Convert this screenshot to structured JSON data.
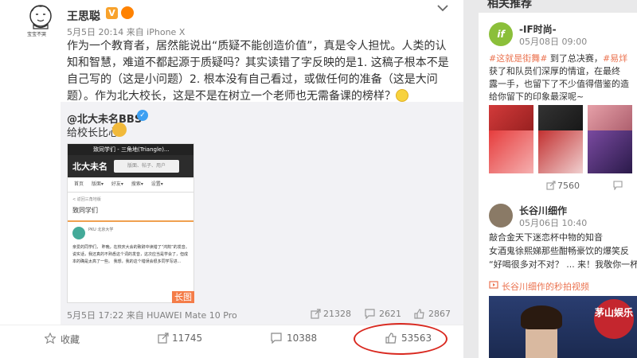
{
  "post": {
    "author": "王思聪",
    "v_badge": "V",
    "meta": "5月5日 20:14 来自 iPhone X",
    "body": "作为一个教育者，居然能说出“质疑不能创造价值”，真是令人担忧。人类的认知和智慧，难道不都起源于质疑吗？其实读错了字反映的是1. 这稿子根本不是自己写的（这是小问题）2. 根本没有自己看过，或做任何的准备（这是大问题）。作为北大校长，这是不是在树立一个老师也无需备课的榜样？",
    "avatar_label": "宝宝不哭"
  },
  "repost": {
    "author": "@北大未名BBS",
    "text": "给校长比心",
    "meta": "5月5日 17:22 来自 HUAWEI Mate 10 Pro",
    "share_count": "21328",
    "comment_count": "2621",
    "like_count": "2867",
    "long_image_tag": "长图",
    "screenshot": {
      "topbar": "致同学们 - 三角地(Triangle)...",
      "brand": "北大未名",
      "search_placeholder": "版面、帖子、用户",
      "nav": [
        "首页",
        "版面▾",
        "好友▾",
        "搜索▾",
        "设置▾"
      ],
      "back": "< 返回三角地版",
      "board_title": "致同学们",
      "poster": "PKU  北京大学",
      "post_text": "亲爱的同学们，\n  昨晚，在校庆大会的致辞中读错了“鸿鹄”的发音。说实话，我还真的不熟悉这个词的发音，这次应当是学会了，但成本的确是太高了一些。\n  我想，我的这个错误会很多同学写进..."
    }
  },
  "actions": {
    "favorite": "收藏",
    "share": "11745",
    "comment": "10388",
    "like": "53563"
  },
  "sidebar": {
    "title": "相关推荐",
    "card1": {
      "name": "-IF时尚-",
      "time": "05月08日 09:00",
      "avatar_text": "if",
      "tag1": "#这就是街舞#",
      "text_mid": " 到了总决赛，",
      "tag2": "#易烊",
      "lines": [
        "获了和队员们深厚的情谊，在最终",
        "露一手，也留下了不少值得借鉴的造",
        "给你留下的印象最深呢~"
      ],
      "views": "7560"
    },
    "card2": {
      "name": "长谷川细作",
      "time": "05月06日 10:40",
      "lines": [
        "敲合金天下迷恋杯中物的知音",
        "女酒鬼徐熙娣那些酣畅豪饮的爆笑反",
        "“好喝很多对不对？ ... 来！我敬你一杯"
      ],
      "link": "长谷川细作的秒拍视频",
      "watermark": "茅山娱乐"
    }
  },
  "colors": {
    "accent": "#eb7350",
    "highlight_circle": "#d9281f"
  }
}
